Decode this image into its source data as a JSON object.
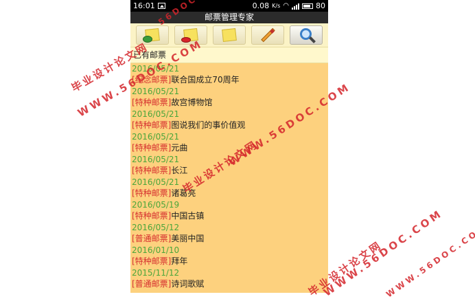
{
  "status": {
    "time": "16:01",
    "speed": "0.08",
    "speed_unit": "K/s",
    "battery": "80"
  },
  "app": {
    "title": "邮票管理专家"
  },
  "toolbar": {
    "buttons": [
      {
        "name": "add",
        "icon": "note-add-icon"
      },
      {
        "name": "delete",
        "icon": "note-delete-icon"
      },
      {
        "name": "note",
        "icon": "note-icon"
      },
      {
        "name": "edit",
        "icon": "pencil-icon"
      },
      {
        "name": "search",
        "icon": "magnifier-icon",
        "active": true
      }
    ]
  },
  "section": {
    "title": "已有邮票"
  },
  "stamps": [
    {
      "date": "2016/05/21",
      "category": "[纪念邮票]",
      "name": "联合国成立70周年"
    },
    {
      "date": "2016/05/21",
      "category": "[特种邮票]",
      "name": "故宫博物馆"
    },
    {
      "date": "2016/05/21",
      "category": "[特种邮票]",
      "name": "图说我们的事价值观"
    },
    {
      "date": "2016/05/21",
      "category": "[特种邮票]",
      "name": "元曲"
    },
    {
      "date": "2016/05/21",
      "category": "[特种邮票]",
      "name": "长江"
    },
    {
      "date": "2016/05/21",
      "category": "[特种邮票]",
      "name": "诸葛亮"
    },
    {
      "date": "2016/05/19",
      "category": "[特种邮票]",
      "name": "中国古镇"
    },
    {
      "date": "2016/05/12",
      "category": "[普通邮票]",
      "name": "美丽中国"
    },
    {
      "date": "2016/01/10",
      "category": "[特种邮票]",
      "name": "拜年"
    },
    {
      "date": "2015/11/12",
      "category": "[普通邮票]",
      "name": "诗词歌赋"
    }
  ],
  "watermarks": {
    "cn": "毕业设计论文网",
    "url": "WWW.56DOC.COM",
    "top_fragment": "56DOC"
  },
  "colors": {
    "list_bg": "#fdd17e",
    "date": "#4aa63b",
    "category": "#d62f2f",
    "watermark": "#d4252b"
  }
}
